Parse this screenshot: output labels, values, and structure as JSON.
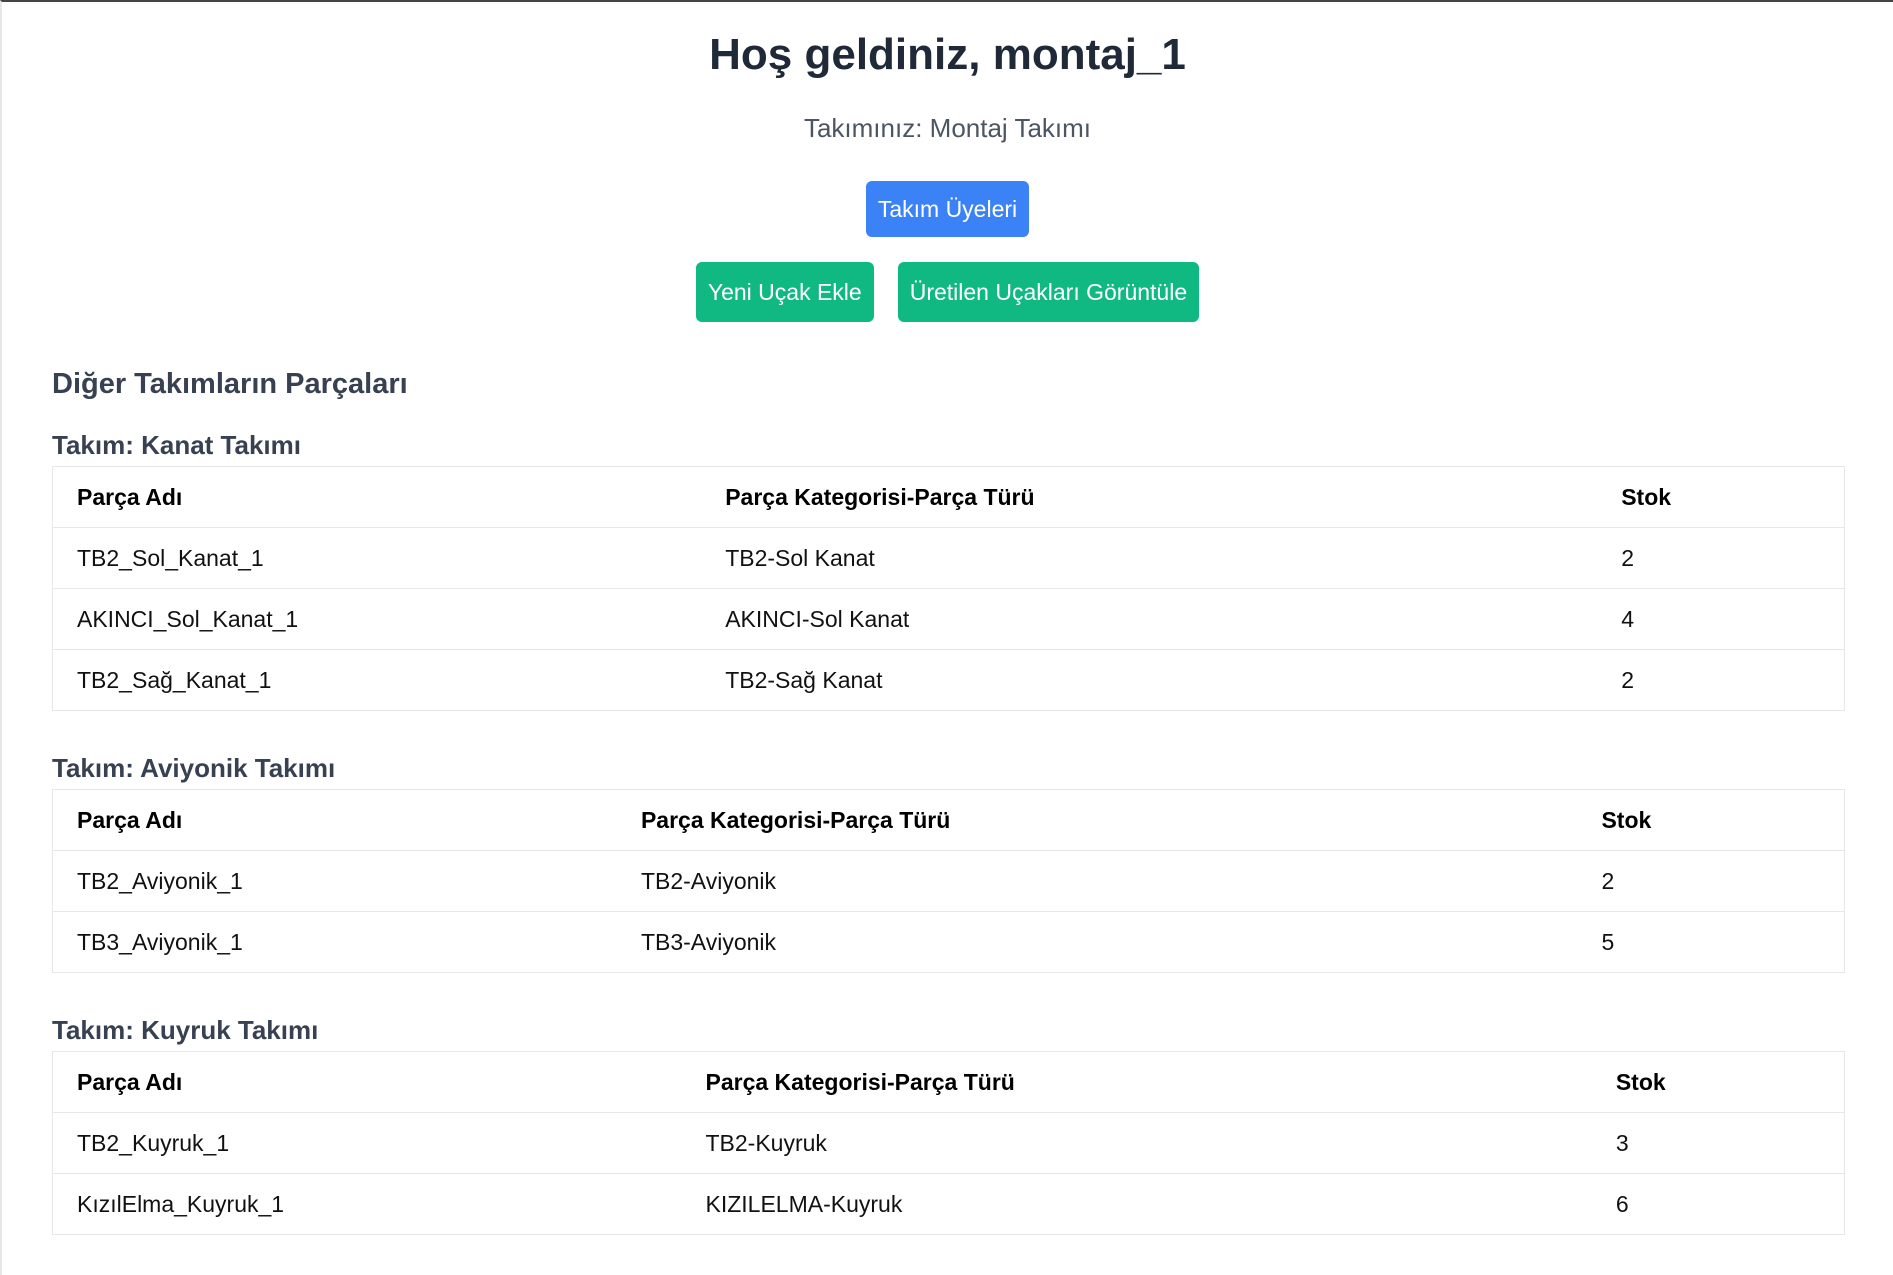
{
  "header": {
    "welcome": "Hoş geldiniz, montaj_1",
    "team_line": "Takımınız: Montaj Takımı"
  },
  "buttons": {
    "team_members": "Takım Üyeleri",
    "add_aircraft": "Yeni Uçak Ekle",
    "view_aircraft": "Üretilen Uçakları Görüntüle"
  },
  "colors": {
    "primary_button": "#3b82f6",
    "success_button": "#10b981"
  },
  "parts_section": {
    "title": "Diğer Takımların Parçaları",
    "columns": [
      "Parça Adı",
      "Parça Kategorisi-Parça Türü",
      "Stok"
    ],
    "teams": [
      {
        "title": "Takım: Kanat Takımı",
        "rows": [
          [
            "TB2_Sol_Kanat_1",
            "TB2-Sol Kanat",
            "2"
          ],
          [
            "AKINCI_Sol_Kanat_1",
            "AKINCI-Sol Kanat",
            "4"
          ],
          [
            "TB2_Sağ_Kanat_1",
            "TB2-Sağ Kanat",
            "2"
          ]
        ]
      },
      {
        "title": "Takım: Aviyonik Takımı",
        "rows": [
          [
            "TB2_Aviyonik_1",
            "TB2-Aviyonik",
            "2"
          ],
          [
            "TB3_Aviyonik_1",
            "TB3-Aviyonik",
            "5"
          ]
        ]
      },
      {
        "title": "Takım: Kuyruk Takımı",
        "rows": [
          [
            "TB2_Kuyruk_1",
            "TB2-Kuyruk",
            "3"
          ],
          [
            "KızılElma_Kuyruk_1",
            "KIZILELMA-Kuyruk",
            "6"
          ]
        ]
      }
    ]
  }
}
